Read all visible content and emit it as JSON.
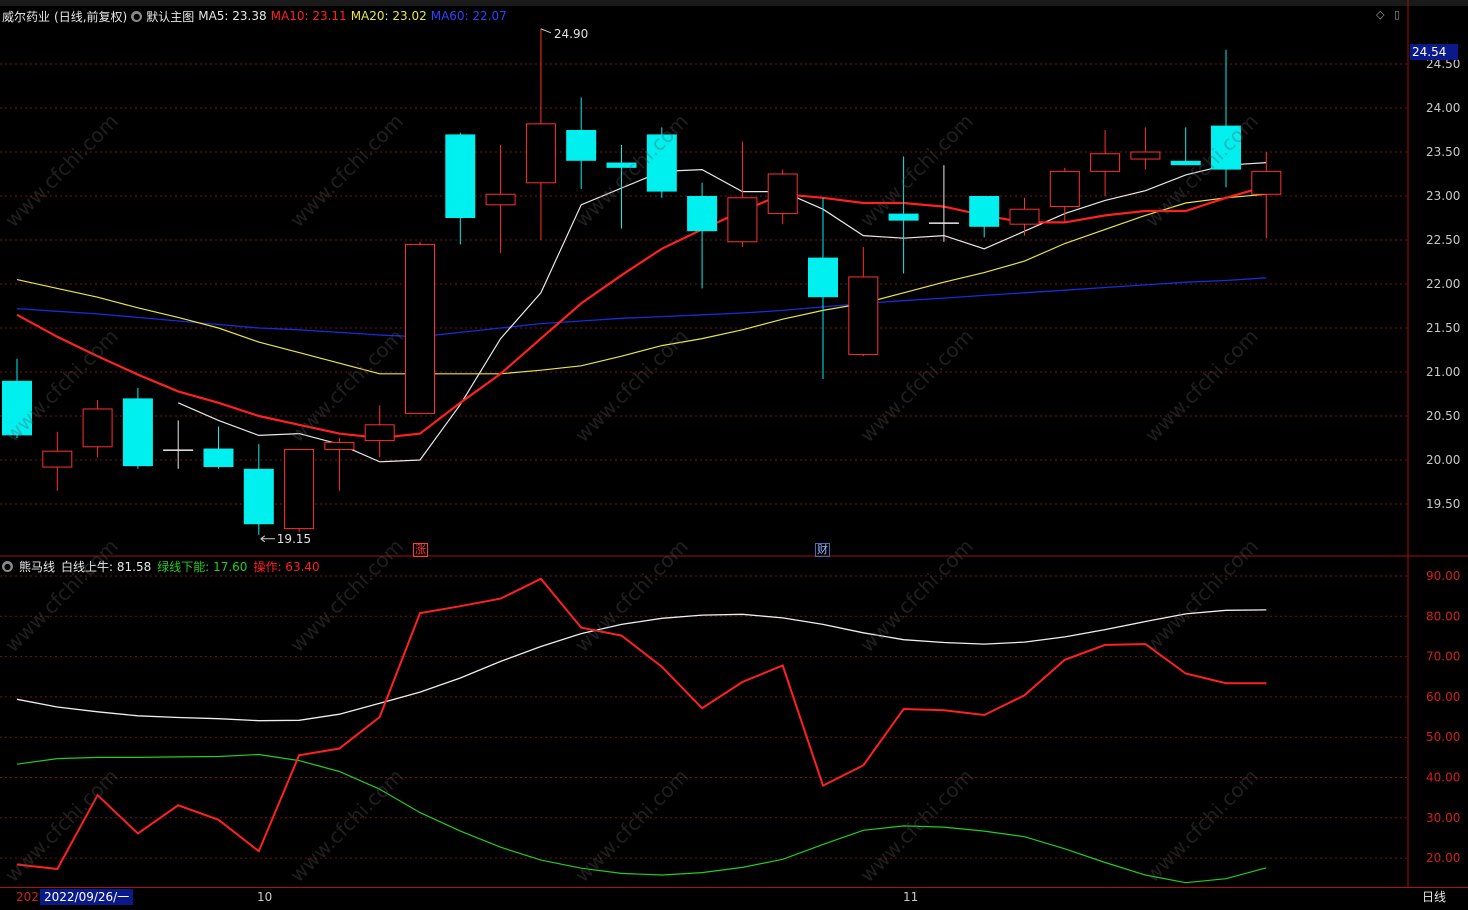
{
  "header": {
    "stock_name": "威尔药业",
    "mode": "(日线,前复权)",
    "chart_label": "默认主图",
    "ma5": "MA5: 23.38",
    "ma10": "MA10: 23.11",
    "ma20": "MA20: 23.02",
    "ma60": "MA60: 22.07"
  },
  "colors": {
    "up": "#ff3030",
    "down": "#00f0f0",
    "ma5": "#e8e8e8",
    "ma10": "#ff2020",
    "ma20": "#e6e645",
    "ma60": "#1a2bd9",
    "grid": "#7a1010",
    "osc_white": "#eeeeee",
    "osc_green": "#22cc22",
    "osc_red": "#ff2020"
  },
  "current_price": "24.54",
  "annotations": {
    "high": "24.90",
    "low": "19.15"
  },
  "markers": {
    "zhang": "涨",
    "cai": "财"
  },
  "price_axis": [
    "24.50",
    "24.00",
    "23.50",
    "23.00",
    "22.50",
    "22.00",
    "21.50",
    "21.00",
    "20.50",
    "20.00",
    "19.50"
  ],
  "osc_axis": [
    "90.00",
    "80.00",
    "70.00",
    "60.00",
    "50.00",
    "40.00",
    "30.00",
    "20.00"
  ],
  "sub": {
    "title": "熊马线",
    "white": "白线上牛: 81.58",
    "green": "绿线下能: 17.60",
    "red": "操作: 63.40"
  },
  "x_axis": {
    "partial_year": "202",
    "date": "2022/09/26/一",
    "tick_10": "10",
    "tick_11": "11",
    "period": "日线"
  },
  "watermark": "www.cfchi.com",
  "chart_data": {
    "type": "candlestick",
    "candles": [
      {
        "o": 20.9,
        "h": 21.15,
        "l": 20.25,
        "c": 20.28
      },
      {
        "o": 19.92,
        "h": 20.32,
        "l": 19.65,
        "c": 20.1
      },
      {
        "o": 20.15,
        "h": 20.68,
        "l": 20.03,
        "c": 20.58
      },
      {
        "o": 20.7,
        "h": 20.82,
        "l": 19.9,
        "c": 19.93
      },
      {
        "o": 20.12,
        "h": 20.45,
        "l": 19.9,
        "c": 20.12
      },
      {
        "o": 20.13,
        "h": 20.38,
        "l": 19.9,
        "c": 19.92
      },
      {
        "o": 19.9,
        "h": 20.18,
        "l": 19.15,
        "c": 19.27
      },
      {
        "o": 19.22,
        "h": 20.12,
        "l": 19.18,
        "c": 20.12
      },
      {
        "o": 20.12,
        "h": 20.25,
        "l": 19.65,
        "c": 20.2
      },
      {
        "o": 20.22,
        "h": 20.62,
        "l": 20.03,
        "c": 20.4
      },
      {
        "o": 20.53,
        "h": 22.48,
        "l": 20.52,
        "c": 22.45
      },
      {
        "o": 23.7,
        "h": 23.72,
        "l": 22.45,
        "c": 22.75
      },
      {
        "o": 22.9,
        "h": 23.58,
        "l": 22.35,
        "c": 23.02
      },
      {
        "o": 23.15,
        "h": 24.9,
        "l": 22.5,
        "c": 23.82
      },
      {
        "o": 23.75,
        "h": 24.12,
        "l": 23.08,
        "c": 23.4
      },
      {
        "o": 23.38,
        "h": 23.58,
        "l": 22.63,
        "c": 23.32
      },
      {
        "o": 23.7,
        "h": 23.78,
        "l": 22.98,
        "c": 23.05
      },
      {
        "o": 23.0,
        "h": 23.15,
        "l": 21.95,
        "c": 22.6
      },
      {
        "o": 22.48,
        "h": 23.62,
        "l": 22.42,
        "c": 22.98
      },
      {
        "o": 22.8,
        "h": 23.3,
        "l": 22.68,
        "c": 23.25
      },
      {
        "o": 22.3,
        "h": 22.98,
        "l": 20.92,
        "c": 21.85
      },
      {
        "o": 21.2,
        "h": 22.42,
        "l": 21.18,
        "c": 22.08
      },
      {
        "o": 22.8,
        "h": 23.45,
        "l": 22.12,
        "c": 22.72
      },
      {
        "o": 22.7,
        "h": 23.35,
        "l": 22.48,
        "c": 22.7
      },
      {
        "o": 23.0,
        "h": 23.0,
        "l": 22.53,
        "c": 22.65
      },
      {
        "o": 22.68,
        "h": 22.98,
        "l": 22.55,
        "c": 22.85
      },
      {
        "o": 22.88,
        "h": 23.32,
        "l": 22.7,
        "c": 23.28
      },
      {
        "o": 23.28,
        "h": 23.75,
        "l": 23.0,
        "c": 23.48
      },
      {
        "o": 23.42,
        "h": 23.78,
        "l": 23.3,
        "c": 23.5
      },
      {
        "o": 23.4,
        "h": 23.78,
        "l": 23.35,
        "c": 23.35
      },
      {
        "o": 23.8,
        "h": 24.66,
        "l": 23.1,
        "c": 23.3
      },
      {
        "o": 23.02,
        "h": 23.5,
        "l": 22.52,
        "c": 23.28
      }
    ],
    "ma5": [
      null,
      null,
      null,
      null,
      20.65,
      20.45,
      20.28,
      20.3,
      20.18,
      19.98,
      20.0,
      20.63,
      21.38,
      21.9,
      22.9,
      23.09,
      23.28,
      23.3,
      23.05,
      23.05,
      22.85,
      22.55,
      22.52,
      22.55,
      22.4,
      22.6,
      22.8,
      22.95,
      23.06,
      23.24,
      23.35,
      23.38
    ],
    "ma10": [
      21.65,
      21.4,
      21.18,
      20.97,
      20.78,
      20.65,
      20.5,
      20.4,
      20.3,
      20.25,
      20.3,
      20.65,
      20.98,
      21.38,
      21.78,
      22.1,
      22.4,
      22.62,
      22.83,
      23.02,
      22.98,
      22.92,
      22.92,
      22.88,
      22.78,
      22.7,
      22.7,
      22.78,
      22.83,
      22.83,
      22.98,
      23.11
    ],
    "ma20": [
      22.05,
      21.95,
      21.85,
      21.73,
      21.62,
      21.5,
      21.34,
      21.22,
      21.1,
      20.98,
      20.98,
      20.98,
      20.98,
      21.02,
      21.07,
      21.18,
      21.3,
      21.38,
      21.48,
      21.6,
      21.7,
      21.78,
      21.9,
      22.02,
      22.13,
      22.26,
      22.46,
      22.62,
      22.78,
      22.92,
      22.98,
      23.02
    ],
    "ma60": [
      21.72,
      21.69,
      21.66,
      21.62,
      21.58,
      21.54,
      21.5,
      21.48,
      21.45,
      21.42,
      21.4,
      21.45,
      21.5,
      21.55,
      21.58,
      21.61,
      21.63,
      21.65,
      21.67,
      21.7,
      21.74,
      21.78,
      21.81,
      21.84,
      21.87,
      21.9,
      21.93,
      21.96,
      21.99,
      22.02,
      22.04,
      22.07
    ],
    "osc_white": [
      59.4,
      57.5,
      56.3,
      55.3,
      54.9,
      54.6,
      54.1,
      54.2,
      55.7,
      58.4,
      61.2,
      64.7,
      68.8,
      72.5,
      75.7,
      78.0,
      79.5,
      80.3,
      80.5,
      79.6,
      78.0,
      75.9,
      74.2,
      73.5,
      73.1,
      73.6,
      74.9,
      76.7,
      78.7,
      80.6,
      81.5,
      81.58
    ],
    "osc_green": [
      43.3,
      44.7,
      45.0,
      45.0,
      45.1,
      45.2,
      45.7,
      44.2,
      41.5,
      37.1,
      31.3,
      26.7,
      22.7,
      19.5,
      17.5,
      16.2,
      15.8,
      16.4,
      17.7,
      19.7,
      23.4,
      26.9,
      28.0,
      27.7,
      26.7,
      25.3,
      22.3,
      18.9,
      15.8,
      13.9,
      14.9,
      17.6
    ],
    "osc_red": [
      18.4,
      17.3,
      35.6,
      26.1,
      33.1,
      29.5,
      21.7,
      45.5,
      47.2,
      55.0,
      80.8,
      82.5,
      84.4,
      89.3,
      77.2,
      75.2,
      67.5,
      57.2,
      63.7,
      67.8,
      38.0,
      43.0,
      57.0,
      56.7,
      55.5,
      60.4,
      69.2,
      72.9,
      73.1,
      65.8,
      63.4,
      63.4
    ],
    "price_range": [
      19.0,
      24.75
    ],
    "osc_range": [
      15,
      94
    ]
  }
}
